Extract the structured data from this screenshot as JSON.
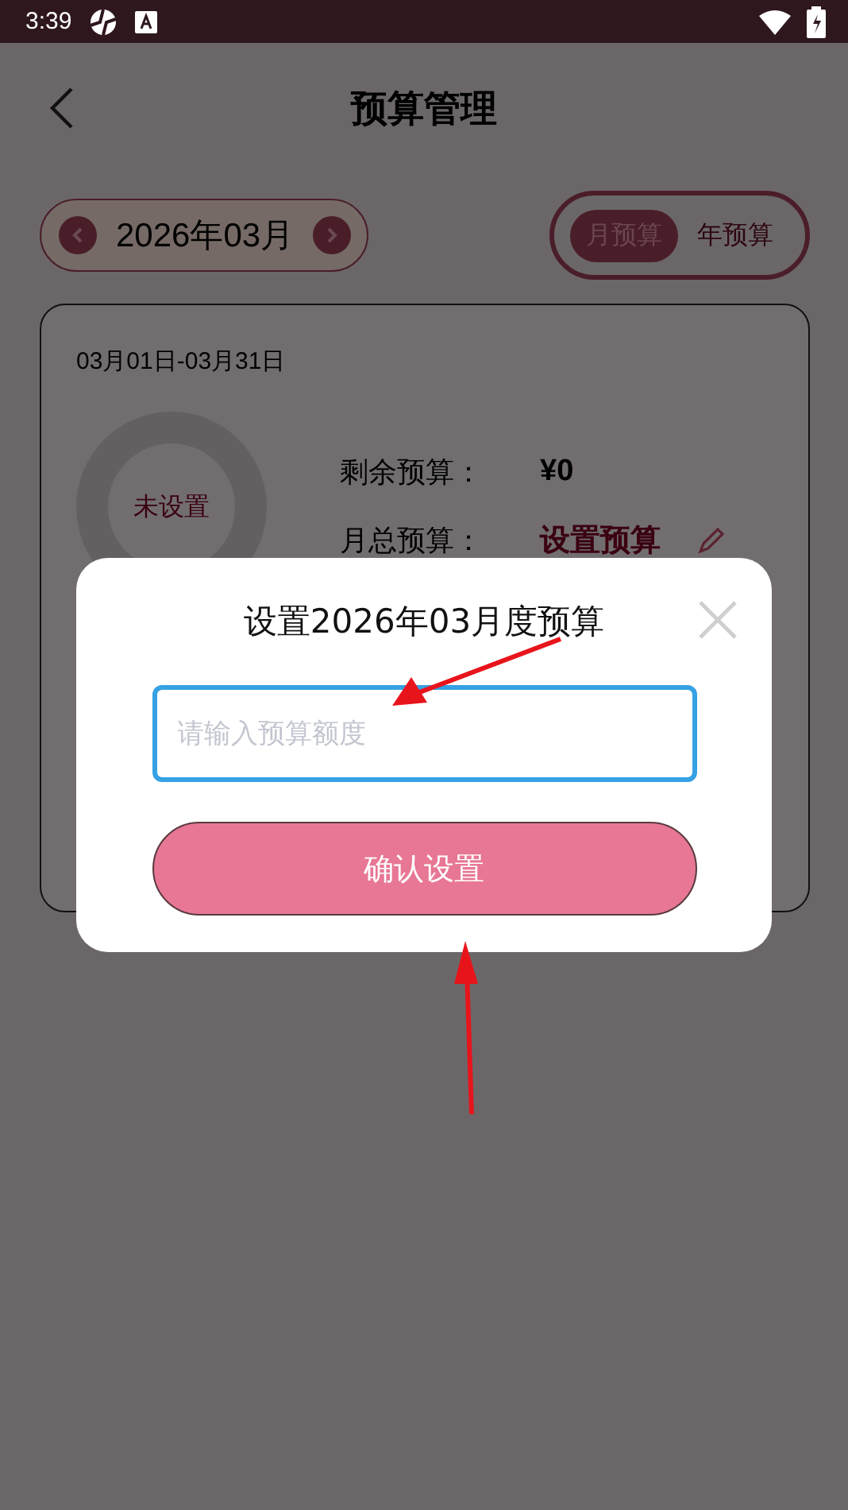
{
  "status_bar": {
    "time": "3:39"
  },
  "header": {
    "title": "预算管理"
  },
  "month_selector": {
    "label": "2026年03月"
  },
  "period_tabs": [
    {
      "label": "月预算",
      "selected": true
    },
    {
      "label": "年预算",
      "selected": false
    }
  ],
  "budget_card": {
    "date_range": "03月01日-03月31日",
    "donut_label": "未设置",
    "rows": [
      {
        "label": "剩余预算：",
        "value": "¥0",
        "kind": "amount"
      },
      {
        "label": "月总预算：",
        "value": "设置预算",
        "kind": "link"
      }
    ]
  },
  "dialog": {
    "title": "设置2026年03月度预算",
    "placeholder": "请输入预算额度",
    "confirm_button": "确认设置"
  }
}
